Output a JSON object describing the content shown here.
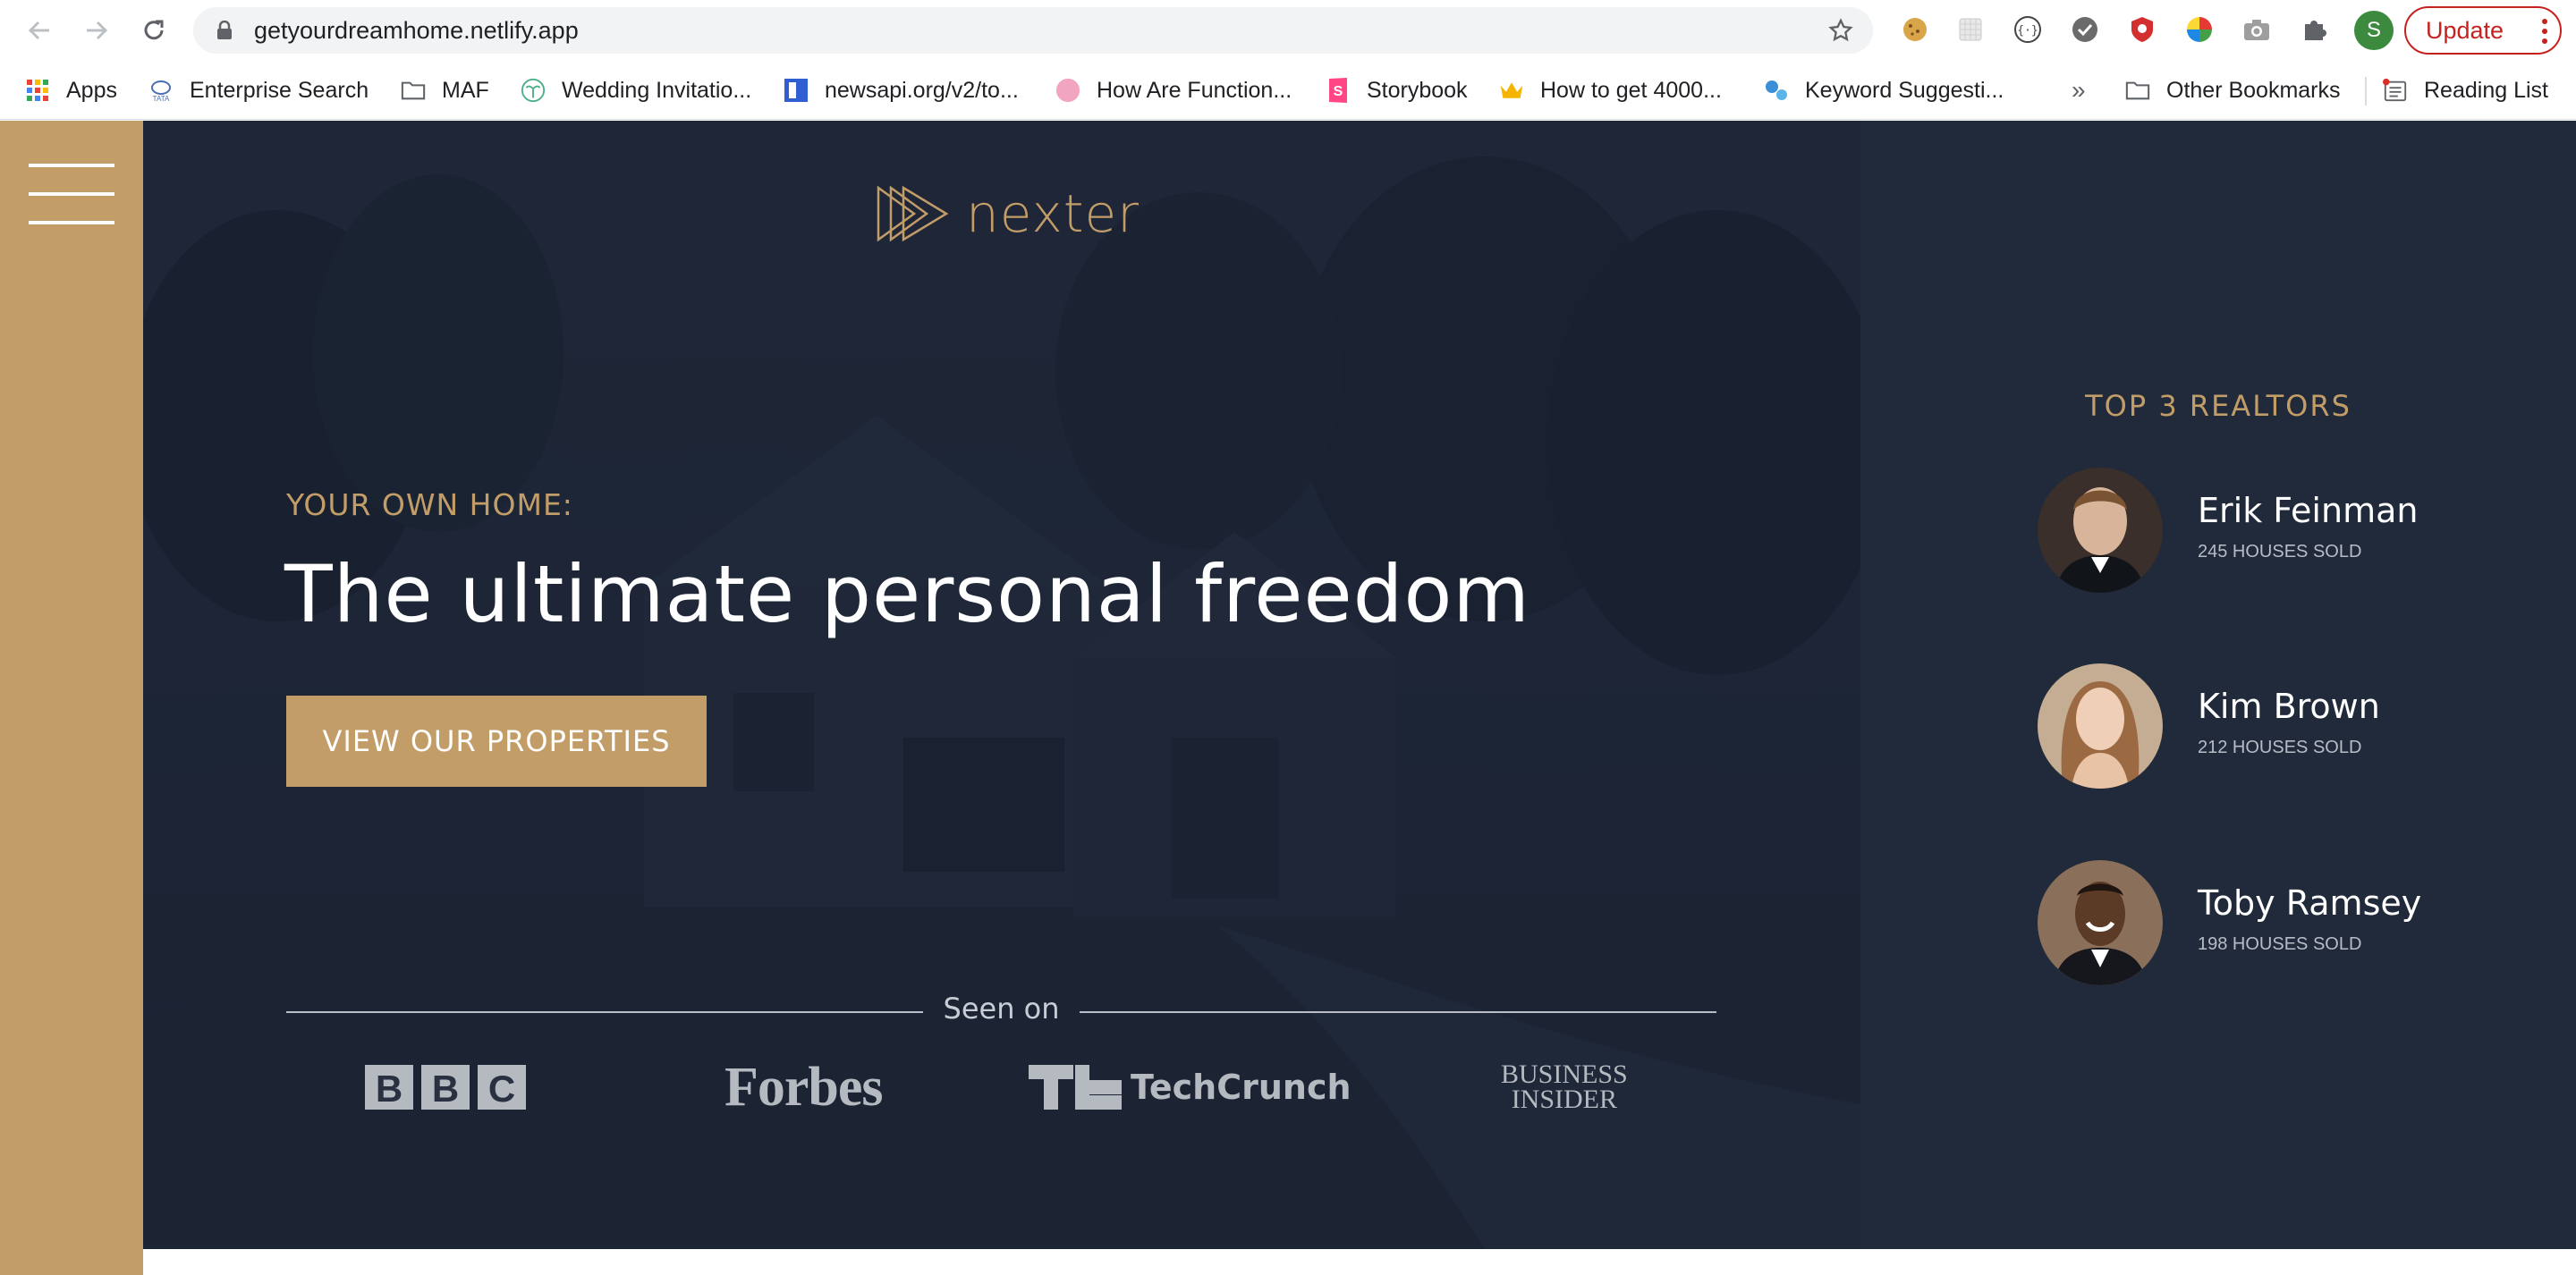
{
  "browser": {
    "url": "getyourdreamhome.netlify.app",
    "profile_initial": "S",
    "update_label": "Update",
    "extensions": [
      "cookie-icon",
      "grid-extension-icon",
      "code-braces-icon",
      "check-circle-icon",
      "shield-icon",
      "color-wheel-icon",
      "camera-icon",
      "puzzle-icon"
    ]
  },
  "bookmarks": {
    "items": [
      {
        "label": "Apps",
        "icon": "apps-grid-icon"
      },
      {
        "label": "Enterprise Search",
        "icon": "tata-icon"
      },
      {
        "label": "MAF",
        "icon": "folder-icon"
      },
      {
        "label": "Wedding Invitatio...",
        "icon": "palm-icon"
      },
      {
        "label": "newsapi.org/v2/to...",
        "icon": "newsapi-icon"
      },
      {
        "label": "How Are Function...",
        "icon": "pink-dot-icon"
      },
      {
        "label": "Storybook",
        "icon": "storybook-icon"
      },
      {
        "label": "How to get 4000...",
        "icon": "crown-icon"
      },
      {
        "label": "Keyword Suggesti...",
        "icon": "keyword-icon"
      }
    ],
    "overflow": "»",
    "other": "Other Bookmarks",
    "reading_list": "Reading List"
  },
  "page": {
    "logo_text": "nexter",
    "hero": {
      "subtitle": "YOUR OWN HOME:",
      "title": "The ultimate personal freedom",
      "cta": "VIEW OUR PROPERTIES"
    },
    "seen_on": {
      "label": "Seen on",
      "logos": [
        "BBC",
        "Forbes",
        "TechCrunch",
        "BUSINESS",
        "INSIDER"
      ]
    },
    "realtors": {
      "title": "TOP 3 REALTORS",
      "items": [
        {
          "name": "Erik Feinman",
          "sold": "245 HOUSES SOLD"
        },
        {
          "name": "Kim Brown",
          "sold": "212 HOUSES SOLD"
        },
        {
          "name": "Toby Ramsey",
          "sold": "198 HOUSES SOLD"
        }
      ]
    }
  },
  "colors": {
    "gold": "#c29d68",
    "hero_dark": "#263041",
    "realtor_panel": "#212a3a",
    "update_red": "#c5221f"
  }
}
